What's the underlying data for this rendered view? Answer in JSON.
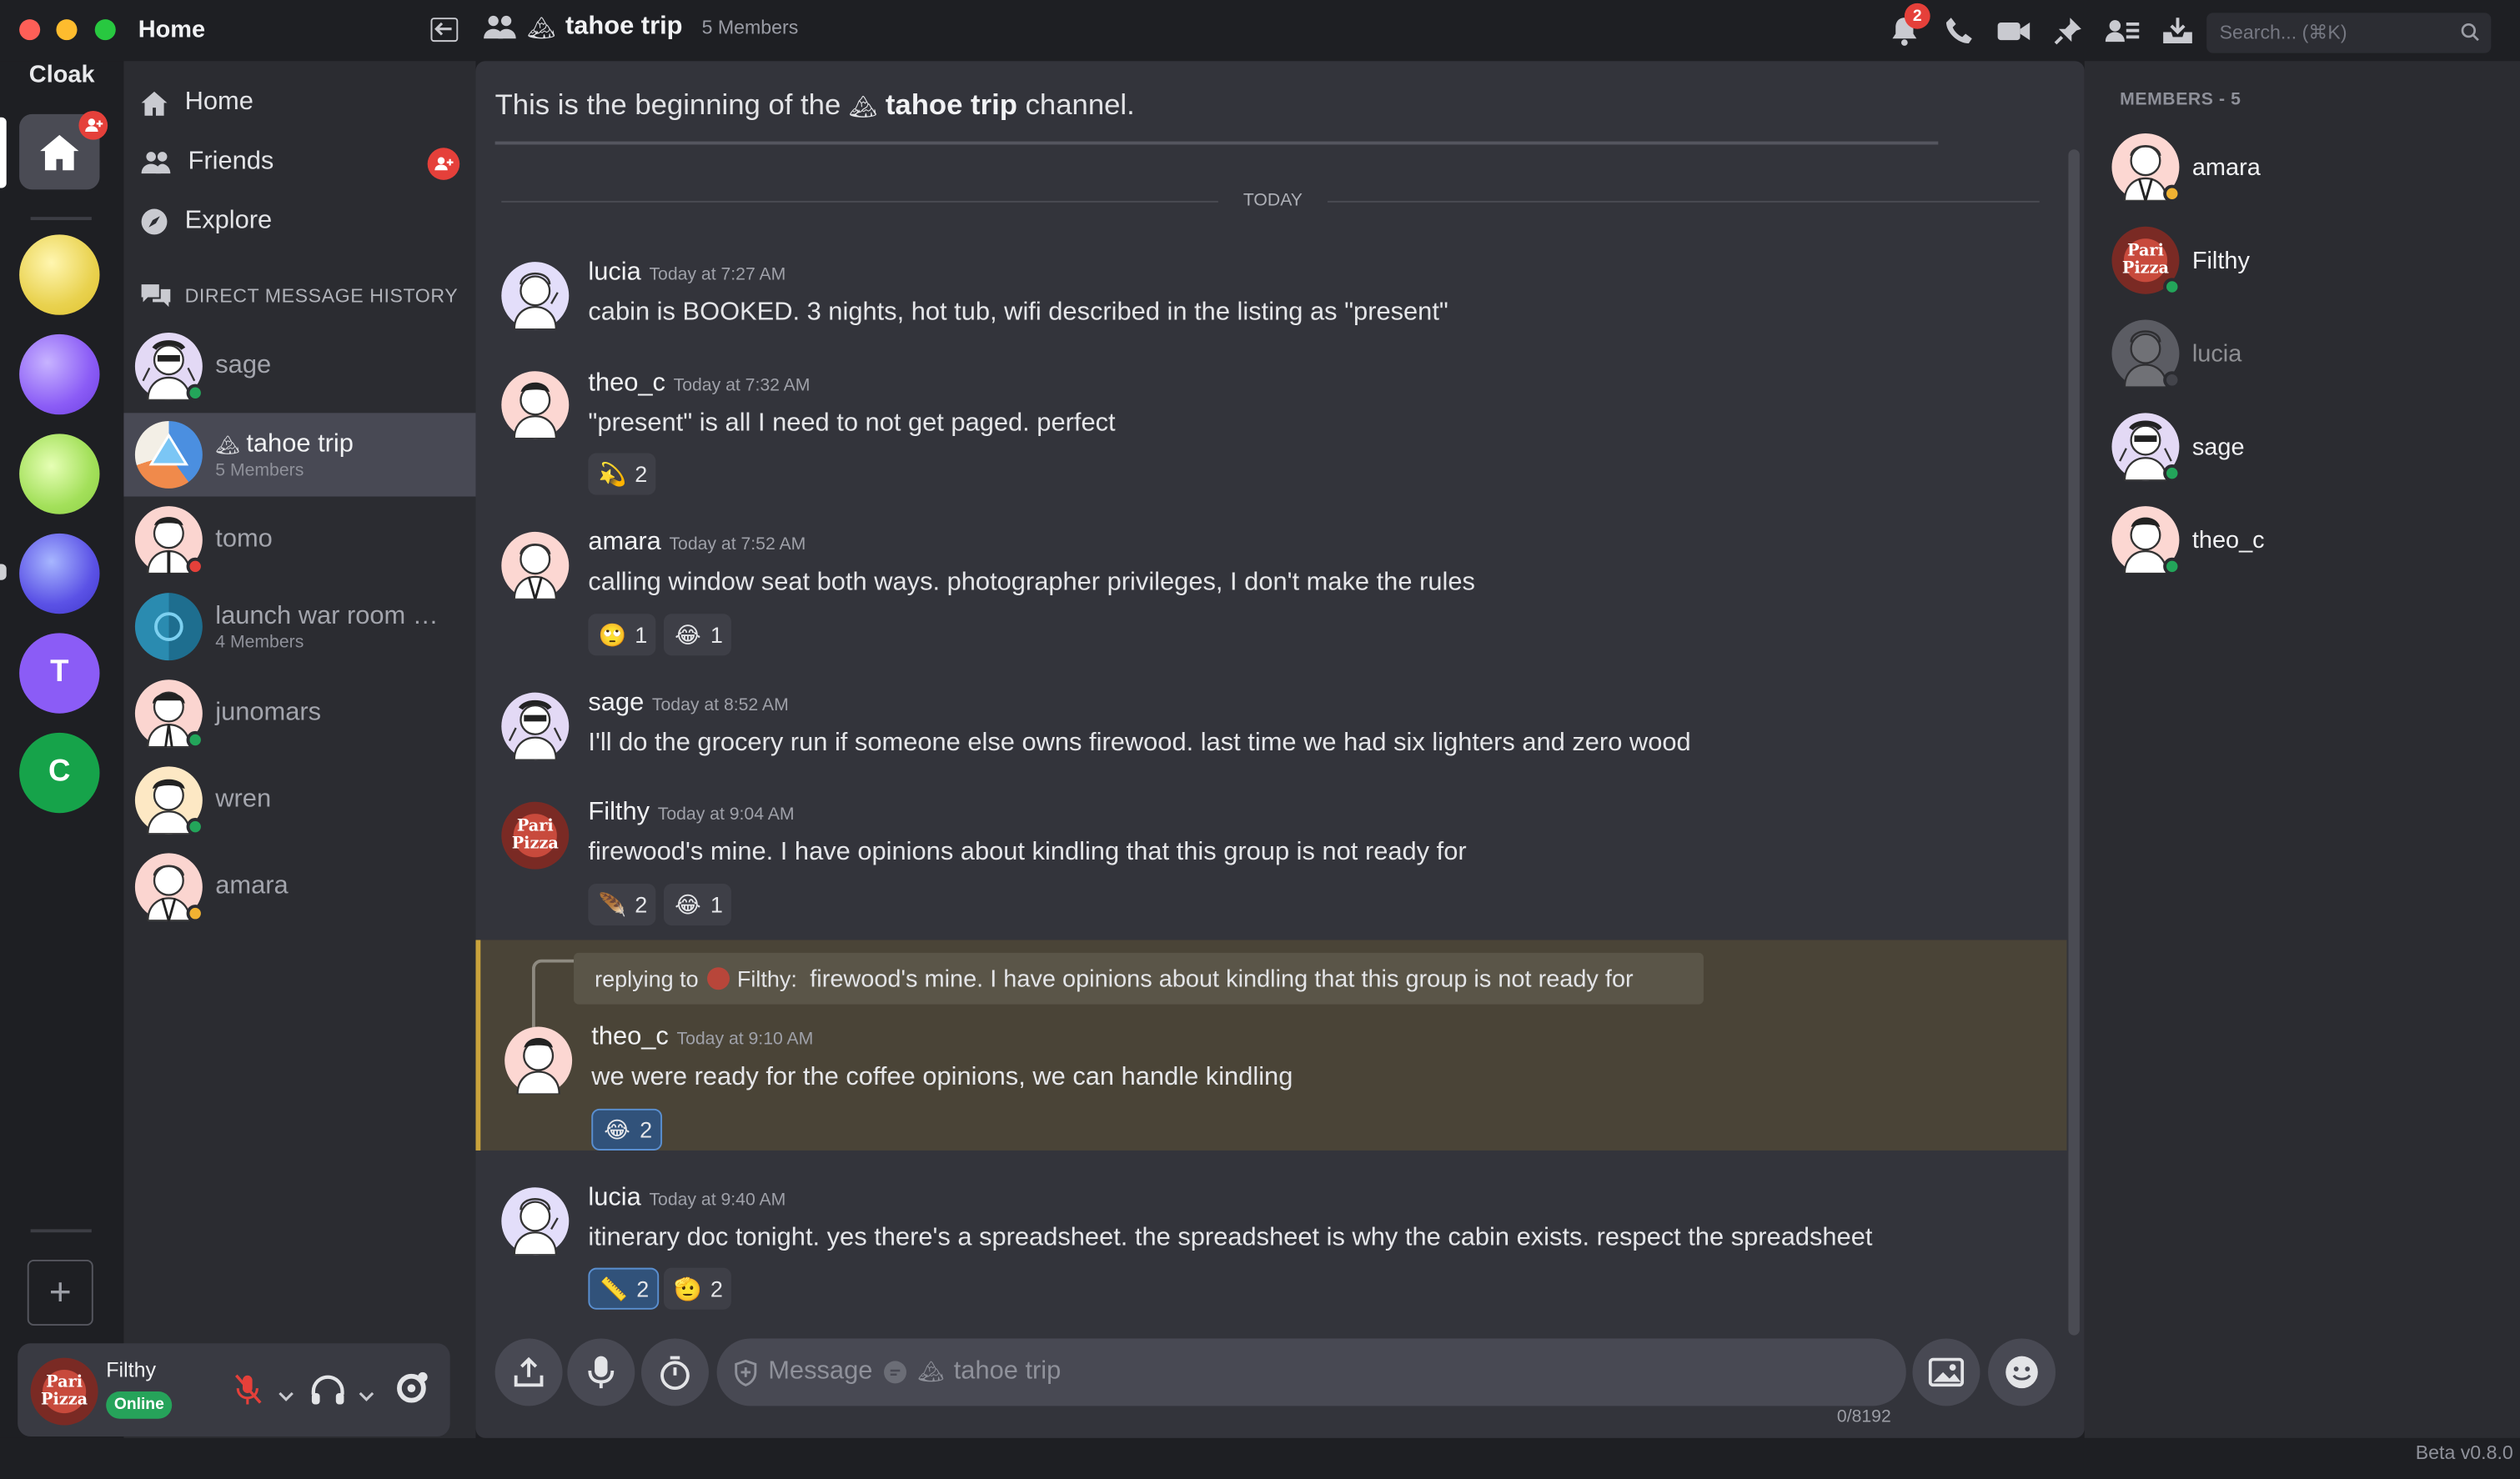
{
  "window": {
    "sidebar_title": "Home",
    "app_name": "Cloak"
  },
  "rail": {
    "home_badge_icon": "person-add-icon",
    "servers": [
      {
        "letter": "",
        "color": "#e9d24f"
      },
      {
        "letter": "",
        "color": "#8b5cf6"
      },
      {
        "letter": "",
        "color": "#a3e05a"
      },
      {
        "letter": "",
        "color": "#5b52e6"
      },
      {
        "letter": "T",
        "color": "#8b5cf6"
      },
      {
        "letter": "C",
        "color": "#16a34a"
      }
    ],
    "add_label": "+"
  },
  "nav": {
    "home": "Home",
    "friends": "Friends",
    "explore": "Explore",
    "dm_history": "DIRECT MESSAGE HISTORY"
  },
  "dms": [
    {
      "name": "sage",
      "sub": "",
      "status": "#23a55a",
      "bg": "#e3d9f5"
    },
    {
      "name": "tahoe trip",
      "sub": "5 Members",
      "status": "",
      "bg": "#4b8fe0"
    },
    {
      "name": "tomo",
      "sub": "",
      "status": "#e5403a",
      "bg": "#fbd5d0"
    },
    {
      "name": "launch war room …",
      "sub": "4 Members",
      "status": "",
      "bg": "#1e6e8f"
    },
    {
      "name": "junomars",
      "sub": "",
      "status": "#23a55a",
      "bg": "#fbd5d0"
    },
    {
      "name": "wren",
      "sub": "",
      "status": "#23a55a",
      "bg": "#fde8c4"
    },
    {
      "name": "amara",
      "sub": "",
      "status": "#f0b232",
      "bg": "#fbd5d0"
    }
  ],
  "user": {
    "name": "Filthy",
    "status": "Online"
  },
  "header": {
    "channel": "tahoe trip",
    "members": "5 Members",
    "notif_count": "2",
    "search_placeholder": "Search... (⌘K)"
  },
  "chat": {
    "beginning_prefix": "This is the beginning of the",
    "beginning_channel": "tahoe trip",
    "beginning_suffix": "channel.",
    "today": "TODAY",
    "messages": [
      {
        "author": "lucia",
        "time": "Today at 7:27 AM",
        "text": "cabin is BOOKED. 3 nights, hot tub, wifi described in the listing as \"present\""
      },
      {
        "author": "theo_c",
        "time": "Today at 7:32 AM",
        "text": "\"present\" is all I need to not get paged. perfect",
        "reactions": [
          {
            "emoji": "💫",
            "count": "2"
          }
        ]
      },
      {
        "author": "amara",
        "time": "Today at 7:52 AM",
        "text": "calling window seat both ways. photographer privileges, I don't make the rules",
        "reactions": [
          {
            "emoji": "🙄",
            "count": "1"
          },
          {
            "emoji": "😂",
            "count": "1"
          }
        ]
      },
      {
        "author": "sage",
        "time": "Today at 8:52 AM",
        "text": "I'll do the grocery run if someone else owns firewood. last time we had six lighters and zero wood"
      },
      {
        "author": "Filthy",
        "time": "Today at 9:04 AM",
        "text": "firewood's mine. I have opinions about kindling that this group is not ready for",
        "reactions": [
          {
            "emoji": "🪶",
            "count": "2"
          },
          {
            "emoji": "😂",
            "count": "1"
          }
        ]
      },
      {
        "author": "theo_c",
        "time": "Today at 9:10 AM",
        "text": "we were ready for the coffee opinions, we can handle kindling",
        "reply_label": "replying to",
        "reply_author": "Filthy:",
        "reply_text": "firewood's mine. I have opinions about kindling that this group is not ready for",
        "reactions": [
          {
            "emoji": "😂",
            "count": "2"
          }
        ]
      },
      {
        "author": "lucia",
        "time": "Today at 9:40 AM",
        "text": "itinerary doc tonight. yes there's a spreadsheet. the spreadsheet is why the cabin exists. respect the spreadsheet",
        "reactions": [
          {
            "emoji": "📏",
            "count": "2"
          },
          {
            "emoji": "🫡",
            "count": "2"
          }
        ]
      }
    ]
  },
  "composer": {
    "placeholder": "Message",
    "channel": "tahoe trip",
    "counter": "0/8192"
  },
  "members": {
    "title": "MEMBERS - 5",
    "list": [
      {
        "name": "amara",
        "status": "#f0b232",
        "dim": false
      },
      {
        "name": "Filthy",
        "status": "#23a55a",
        "dim": false
      },
      {
        "name": "lucia",
        "status": "#5b5d66",
        "dim": true
      },
      {
        "name": "sage",
        "status": "#23a55a",
        "dim": false
      },
      {
        "name": "theo_c",
        "status": "#23a55a",
        "dim": false
      }
    ]
  },
  "footer": {
    "version": "Beta v0.8.0"
  }
}
